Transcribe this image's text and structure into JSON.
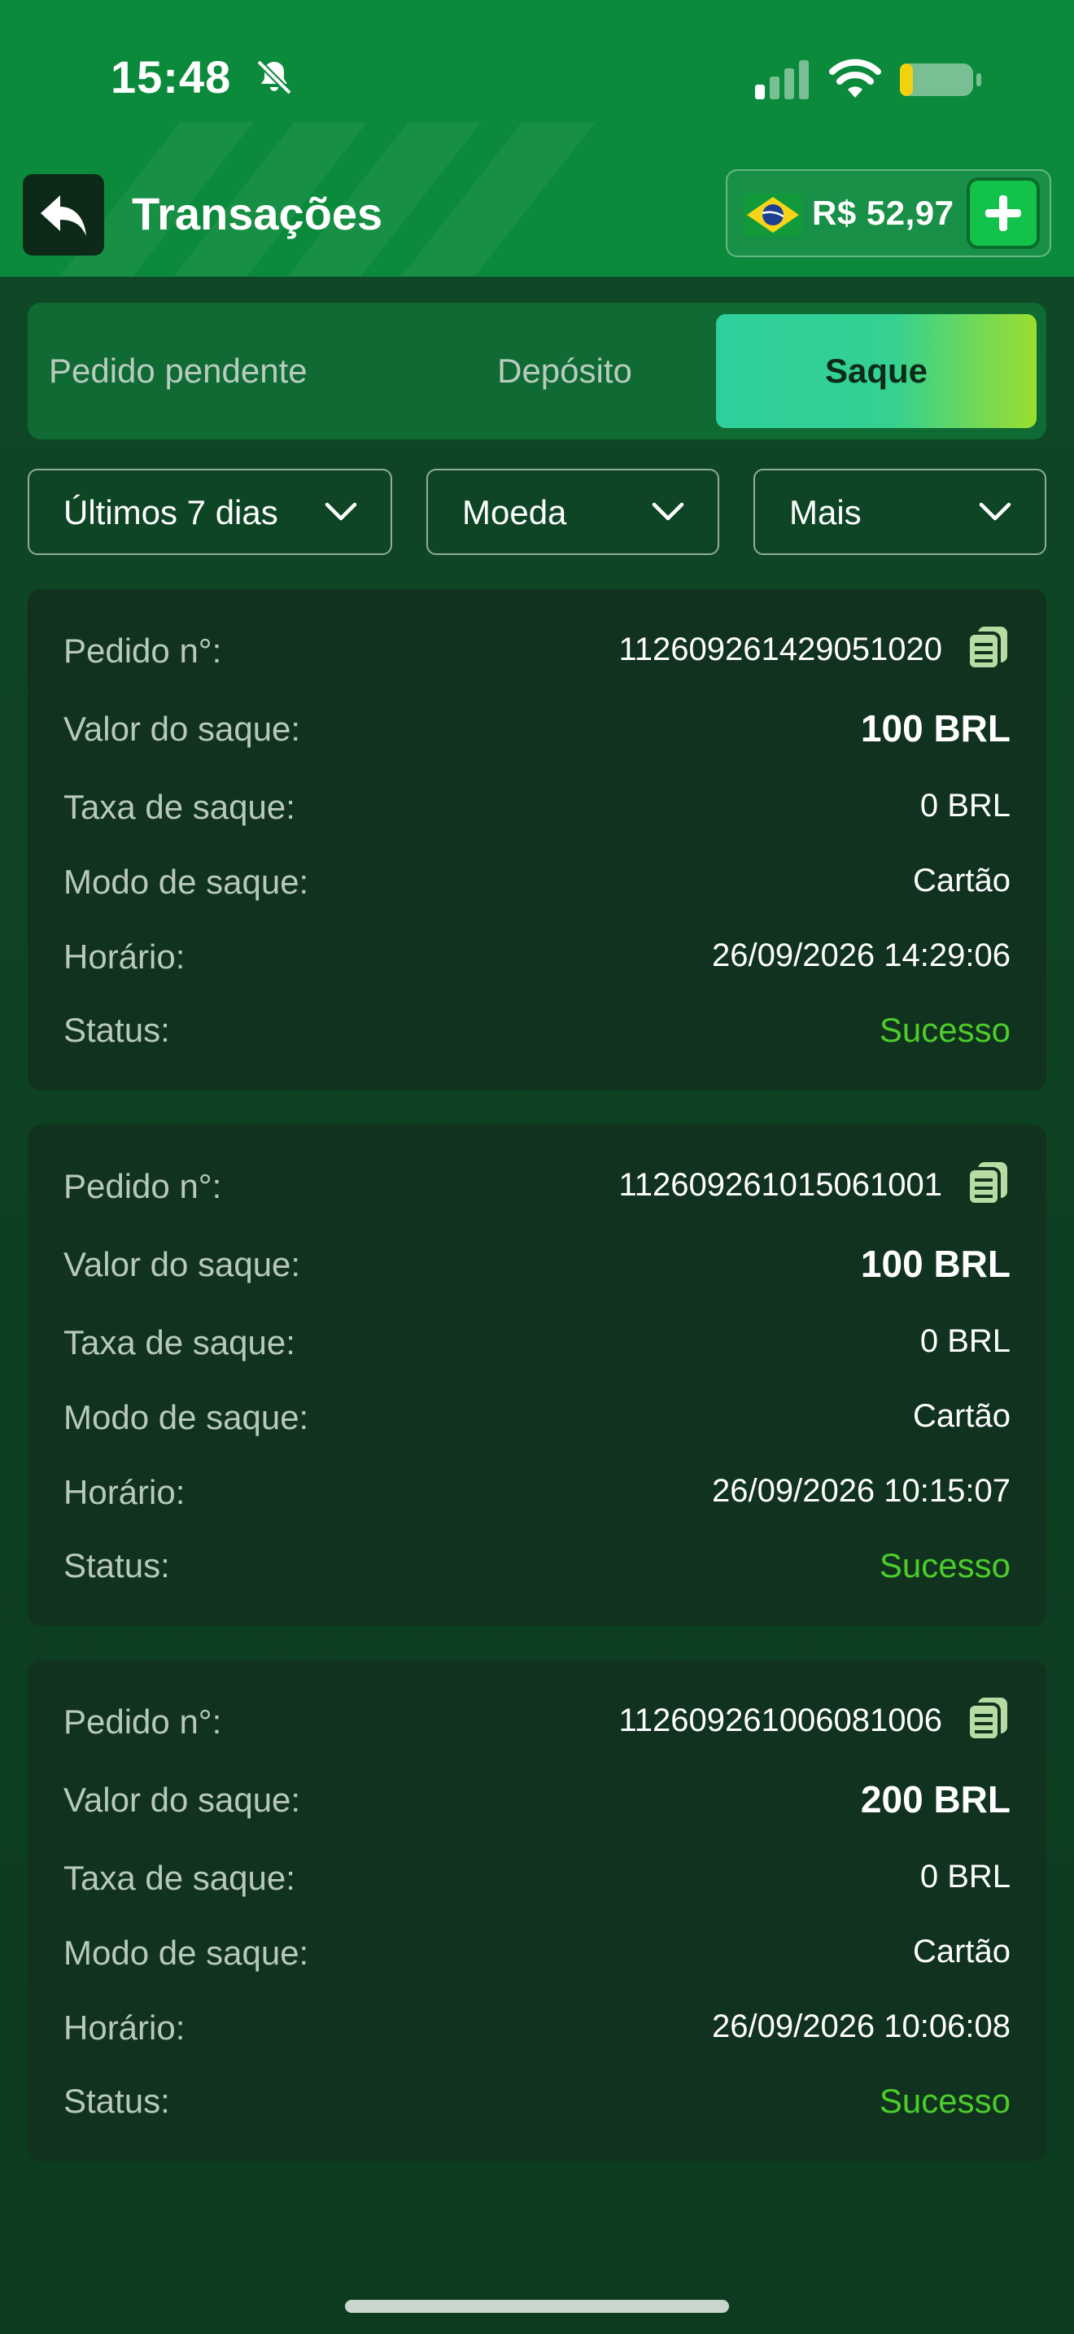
{
  "status_bar": {
    "time": "15:48"
  },
  "header": {
    "title": "Transações",
    "balance": "R$ 52,97"
  },
  "tabs": [
    {
      "label": "Pedido pendente",
      "active": false
    },
    {
      "label": "Depósito",
      "active": false
    },
    {
      "label": "Saque",
      "active": true
    }
  ],
  "filters": [
    {
      "label": "Últimos 7 dias"
    },
    {
      "label": "Moeda"
    },
    {
      "label": "Mais"
    }
  ],
  "field_labels": {
    "order": "Pedido n°:",
    "amount": "Valor do saque:",
    "fee": "Taxa de saque:",
    "mode": "Modo de saque:",
    "time": "Horário:",
    "status": "Status:"
  },
  "transactions": [
    {
      "order_no": "112609261429051020",
      "amount": "100 BRL",
      "fee": "0 BRL",
      "mode": "Cartão",
      "time": "26/09/2026 14:29:06",
      "status": "Sucesso"
    },
    {
      "order_no": "112609261015061001",
      "amount": "100 BRL",
      "fee": "0 BRL",
      "mode": "Cartão",
      "time": "26/09/2026 10:15:07",
      "status": "Sucesso"
    },
    {
      "order_no": "112609261006081006",
      "amount": "200 BRL",
      "fee": "0 BRL",
      "mode": "Cartão",
      "time": "26/09/2026 10:06:08",
      "status": "Sucesso"
    }
  ],
  "icons": {
    "back": "back-arrow-icon",
    "mute": "bell-slash-icon",
    "signal": "cellular-signal-icon",
    "wifi": "wifi-icon",
    "battery": "battery-icon",
    "flag": "brazil-flag-icon",
    "add": "plus-icon",
    "chevron": "chevron-down-icon",
    "copy": "copy-icon"
  },
  "colors": {
    "header_green": "#0b8a3c",
    "background": "#0e4424",
    "card": "#10321f",
    "success": "#4ccd2a",
    "tab_active_start": "#2ecf9c",
    "tab_active_end": "#9bde2f",
    "plus_button": "#12c24a"
  }
}
